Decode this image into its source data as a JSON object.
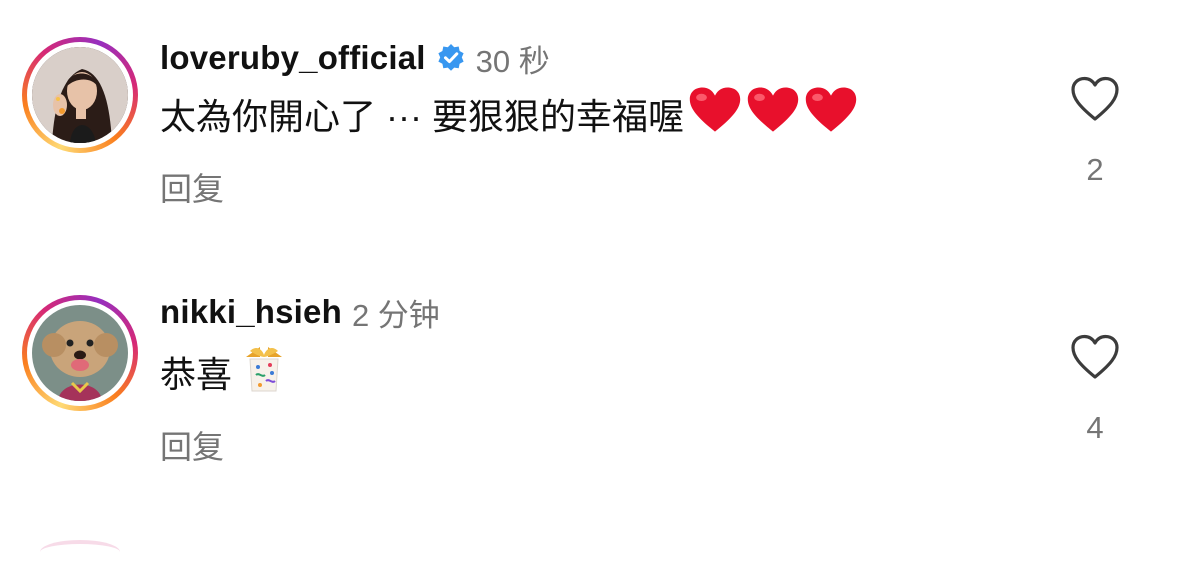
{
  "comments": [
    {
      "username": "loveruby_official",
      "verified": true,
      "time": "30 秒",
      "text": "太為你開心了 ··· 要狠狠的幸福喔",
      "emoji": "heart-emoji x3",
      "reply_label": "回复",
      "like_count": "2",
      "avatar_icon": "portrait-avatar"
    },
    {
      "username": "nikki_hsieh",
      "verified": false,
      "time": "2 分钟",
      "text": "恭喜",
      "emoji": "confetti-emoji",
      "reply_label": "回复",
      "like_count": "4",
      "avatar_icon": "dog-avatar"
    }
  ],
  "colors": {
    "verified_badge": "#3897f0",
    "secondary_text": "#757575",
    "heart_emoji": "#e8102c"
  }
}
